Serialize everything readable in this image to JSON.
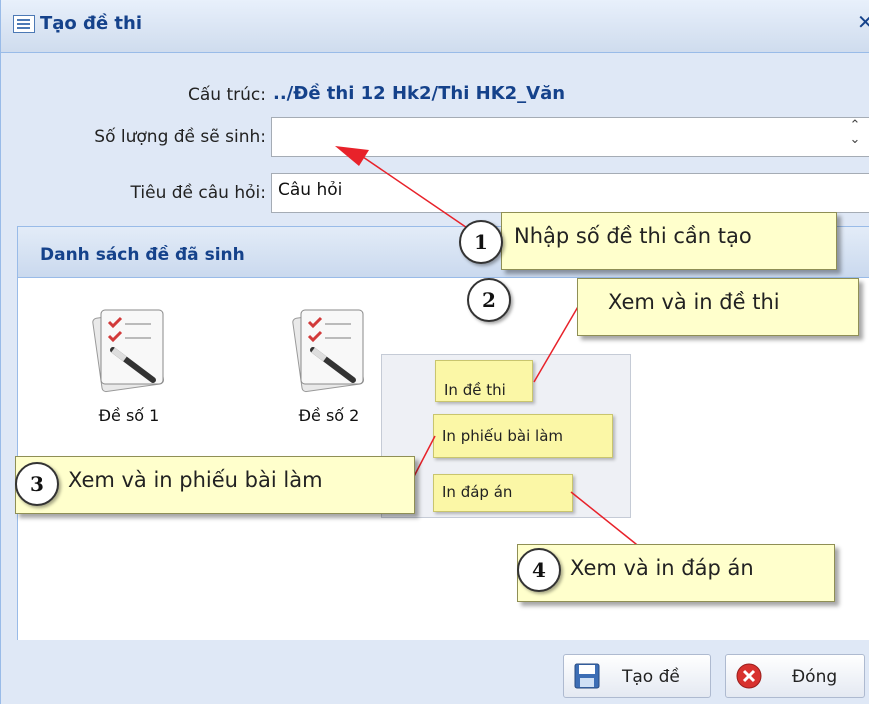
{
  "window": {
    "title": "Tạo đề thi",
    "close_glyph": "✕"
  },
  "form": {
    "structure_label": "Cấu trúc:",
    "structure_value": "../Đề thi 12 Hk2/Thi HK2_Văn",
    "count_label": "Số lượng đề sẽ sinh:",
    "count_value": "",
    "question_title_label": "Tiêu đề câu hỏi:",
    "question_title_value": "Câu hỏi"
  },
  "list_panel": {
    "title": "Danh sách đề đã sinh",
    "items": [
      {
        "label": "Đề số 1",
        "icon": "exam-document-icon"
      },
      {
        "label": "Đề số 2",
        "icon": "exam-document-icon"
      }
    ]
  },
  "context_menu": {
    "print_exam": "In đề thi",
    "print_answer_sheet": "In phiếu bài làm",
    "print_answers": "In đáp án"
  },
  "callouts": [
    {
      "number": "1",
      "text": "Nhập số đề thi cần tạo"
    },
    {
      "number": "2",
      "text": "Xem và in đề thi"
    },
    {
      "number": "3",
      "text": "Xem và in phiếu bài làm"
    },
    {
      "number": "4",
      "text": "Xem và in đáp án"
    }
  ],
  "footer": {
    "create_label": "Tạo đề",
    "close_label": "Đóng"
  },
  "colors": {
    "title_text": "#15428b",
    "callout_bg": "#ffffcc",
    "pointer_arrow": "#e8222a"
  }
}
